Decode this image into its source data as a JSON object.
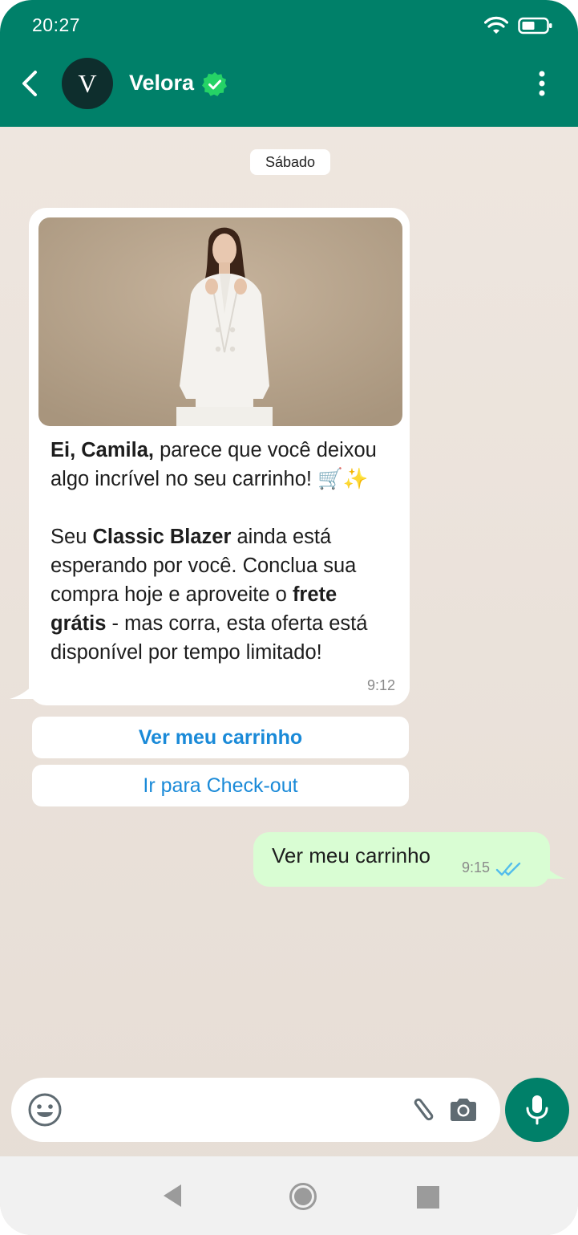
{
  "status_bar": {
    "time": "20:27"
  },
  "header": {
    "avatar_letter": "V",
    "contact_name": "Velora",
    "verified": true
  },
  "chat": {
    "date_label": "Sábado",
    "incoming": {
      "line1_bold": "Ei, Camila,",
      "line1_rest": " parece que você deixou algo incrível no seu carrinho! 🛒✨",
      "p2_a": "Seu ",
      "p2_bold1": "Classic Blazer",
      "p2_b": " ainda está esperando por você. Conclua sua compra hoje e aproveite o ",
      "p2_bold2": "frete grátis",
      "p2_c": " - mas corra, esta oferta está disponível por tempo limitado!",
      "time": "9:12"
    },
    "quick_replies": {
      "primary": "Ver meu carrinho",
      "secondary": "Ir para Check-out"
    },
    "outgoing": {
      "text": "Ver meu carrinho",
      "time": "9:15",
      "status": "read"
    }
  },
  "input": {
    "placeholder": ""
  },
  "colors": {
    "brand": "#008069",
    "link": "#1a8ad8",
    "outgoing_bubble": "#d9fdd3",
    "read_ticks": "#53bdeb"
  }
}
